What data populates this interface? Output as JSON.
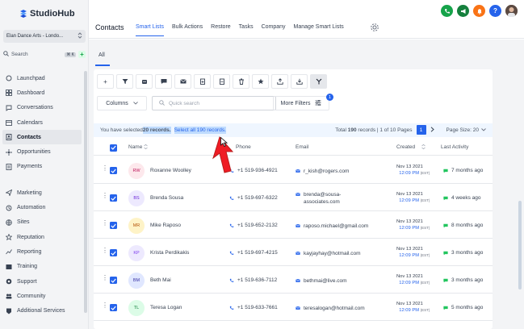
{
  "brand": {
    "name": "StudioHub"
  },
  "account": {
    "name": "Elan Dance Arts - Londo..."
  },
  "search": {
    "label": "Search",
    "shortcut": "⌘ K"
  },
  "sidebar": {
    "items": [
      {
        "label": "Launchpad",
        "icon": "rocket-icon"
      },
      {
        "label": "Dashboard",
        "icon": "grid-icon"
      },
      {
        "label": "Conversations",
        "icon": "chat-icon"
      },
      {
        "label": "Calendars",
        "icon": "calendar-icon"
      },
      {
        "label": "Contacts",
        "icon": "contacts-icon"
      },
      {
        "label": "Opportunities",
        "icon": "opportunities-icon"
      },
      {
        "label": "Payments",
        "icon": "payments-icon"
      },
      {
        "label": "Marketing",
        "icon": "send-icon"
      },
      {
        "label": "Automation",
        "icon": "automation-icon"
      },
      {
        "label": "Sites",
        "icon": "globe-icon"
      },
      {
        "label": "Reputation",
        "icon": "star-icon"
      },
      {
        "label": "Reporting",
        "icon": "chart-icon"
      },
      {
        "label": "Training",
        "icon": "book-icon"
      },
      {
        "label": "Support",
        "icon": "support-icon"
      },
      {
        "label": "Community",
        "icon": "community-icon"
      },
      {
        "label": "Additional Services",
        "icon": "services-icon"
      }
    ]
  },
  "header": {
    "title": "Contacts",
    "tabs": [
      "Smart Lists",
      "Bulk Actions",
      "Restore",
      "Tasks",
      "Company",
      "Manage Smart Lists"
    ],
    "icon_colors": [
      "#16a34a",
      "#15803d",
      "#f97316",
      "#2563eb"
    ]
  },
  "main": {
    "list_tab": "All",
    "columns_label": "Columns",
    "quick_search_placeholder": "Quick search",
    "more_filters_label": "More Filters",
    "filter_count": "1",
    "selection": {
      "prefix": "You have selected ",
      "count": "20 records.",
      "select_all": "Select all 190 records.",
      "total_prefix": "Total ",
      "total": "190",
      "total_suffix": " records | ",
      "page_info": "1 of 10 Pages",
      "current_page": "1",
      "page_size": "Page Size: 20"
    },
    "columns": {
      "name": "Name",
      "phone": "Phone",
      "email": "Email",
      "created": "Created",
      "activity": "Last Activity"
    },
    "rows": [
      {
        "initials": "RW",
        "name": "Roxanne Woolley",
        "phone": "+1 519-936-4921",
        "email": "r_kish@rogers.com",
        "email2": "",
        "created_date": "Nov 13 2021",
        "created_time": "12:09 PM",
        "tz": "(EST)",
        "activity": "7 months ago",
        "avatar_bg": "#fde8ec",
        "avatar_fg": "#be185d"
      },
      {
        "initials": "BS",
        "name": "Brenda Sousa",
        "phone": "+1 519-697-6322",
        "email": "brenda@sousa-",
        "email2": "associates.com",
        "created_date": "Nov 13 2021",
        "created_time": "12:09 PM",
        "tz": "(EST)",
        "activity": "4 weeks ago",
        "avatar_bg": "#ede9fe",
        "avatar_fg": "#6d28d9"
      },
      {
        "initials": "MR",
        "name": "Mike Raposo",
        "phone": "+1 519-652-2132",
        "email": "raposo.michael@gmail.com",
        "email2": "",
        "created_date": "Nov 13 2021",
        "created_time": "12:09 PM",
        "tz": "(EST)",
        "activity": "8 months ago",
        "avatar_bg": "#fef3c7",
        "avatar_fg": "#b45309"
      },
      {
        "initials": "KP",
        "name": "Krista Perdikakis",
        "phone": "+1 519-697-4215",
        "email": "kayjayhay@hotmail.com",
        "email2": "",
        "created_date": "Nov 13 2021",
        "created_time": "12:09 PM",
        "tz": "(EST)",
        "activity": "3 months ago",
        "avatar_bg": "#ede9fe",
        "avatar_fg": "#7c3aed"
      },
      {
        "initials": "BM",
        "name": "Beth Mai",
        "phone": "+1 519-636-7112",
        "email": "bethmai@live.com",
        "email2": "",
        "created_date": "Nov 13 2021",
        "created_time": "12:09 PM",
        "tz": "(EST)",
        "activity": "3 months ago",
        "avatar_bg": "#e0e7ff",
        "avatar_fg": "#3730a3"
      },
      {
        "initials": "TL",
        "name": "Teresa Logan",
        "phone": "+1 519-633-7661",
        "email": "teresalogan@hotmail.com",
        "email2": "",
        "created_date": "Nov 13 2021",
        "created_time": "12:09 PM",
        "tz": "(EST)",
        "activity": "5 months ago",
        "avatar_bg": "#dcfce7",
        "avatar_fg": "#15803d"
      }
    ]
  }
}
